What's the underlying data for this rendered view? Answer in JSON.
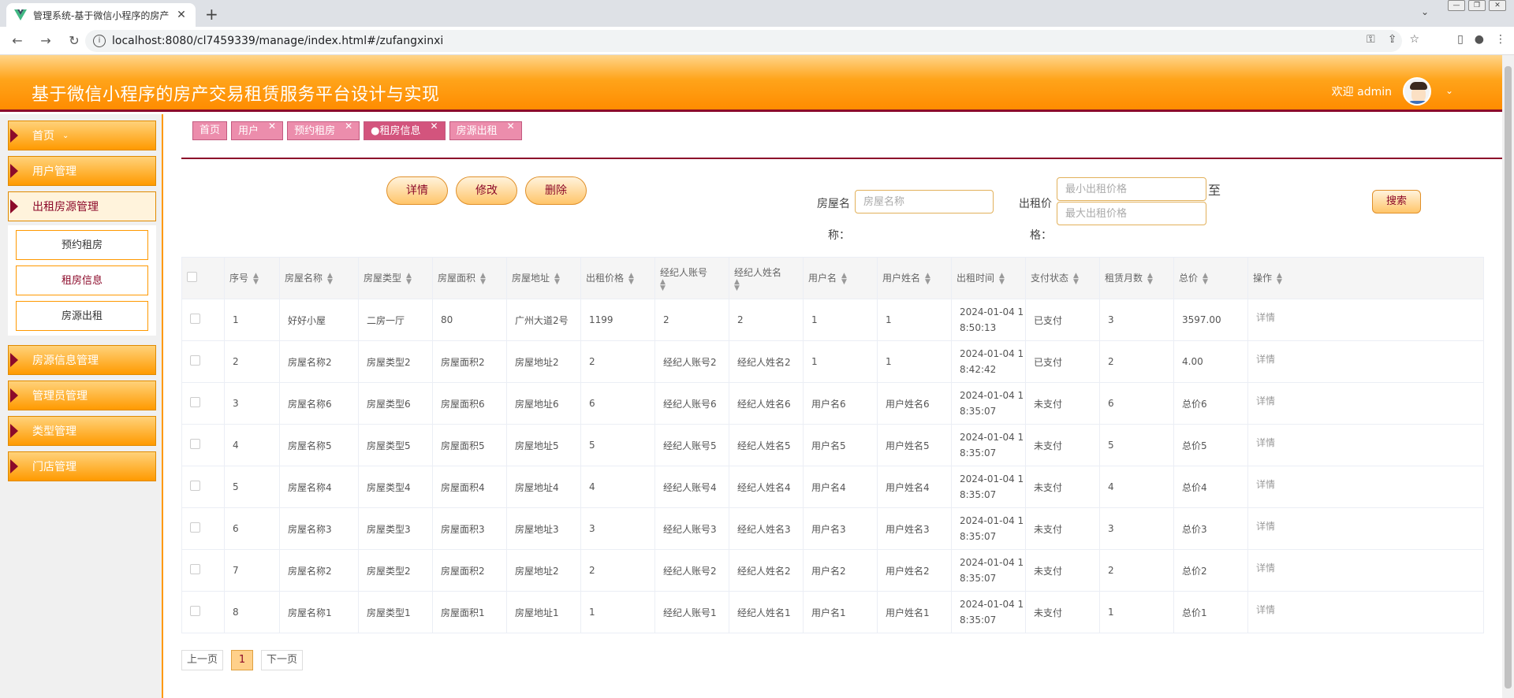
{
  "browser": {
    "tab_title": "管理系统-基于微信小程序的房产",
    "url": "localhost:8080/cl7459339/manage/index.html#/zufangxinxi"
  },
  "header": {
    "title": "基于微信小程序的房产交易租赁服务平台设计与实现",
    "welcome": "欢迎 admin"
  },
  "sidebar": {
    "items": [
      {
        "label": "首页"
      },
      {
        "label": "用户管理"
      },
      {
        "label": "出租房源管理"
      },
      {
        "label": "房源信息管理"
      },
      {
        "label": "管理员管理"
      },
      {
        "label": "类型管理"
      },
      {
        "label": "门店管理"
      }
    ],
    "submenu": [
      {
        "label": "预约租房"
      },
      {
        "label": "租房信息"
      },
      {
        "label": "房源出租"
      }
    ]
  },
  "tags": [
    {
      "label": "首页"
    },
    {
      "label": "用户"
    },
    {
      "label": "预约租房"
    },
    {
      "label": "●租房信息"
    },
    {
      "label": "房源出租"
    }
  ],
  "actions": {
    "detail": "详情",
    "edit": "修改",
    "delete": "删除"
  },
  "search": {
    "name_label_1": "房屋名",
    "name_label_2": "称：",
    "name_placeholder": "房屋名称",
    "price_label_1": "出租价",
    "price_label_2": "格：",
    "min_placeholder": "最小出租价格",
    "max_placeholder": "最大出租价格",
    "to": "至",
    "button": "搜索"
  },
  "table": {
    "columns": [
      "序号",
      "房屋名称",
      "房屋类型",
      "房屋面积",
      "房屋地址",
      "出租价格",
      "经纪人账号",
      "经纪人姓名",
      "用户名",
      "用户姓名",
      "出租时间",
      "支付状态",
      "租赁月数",
      "总价",
      "操作"
    ],
    "rows": [
      {
        "no": "1",
        "name": "好好小屋",
        "type": "二房一厅",
        "area": "80",
        "addr": "广州大道2号",
        "price": "1199",
        "agent_acc": "2",
        "agent_name": "2",
        "user": "1",
        "user_name": "1",
        "time_1": "2024-01-04 1",
        "time_2": "8:50:13",
        "status": "已支付",
        "months": "3",
        "total": "3597.00",
        "op": "详情"
      },
      {
        "no": "2",
        "name": "房屋名称2",
        "type": "房屋类型2",
        "area": "房屋面积2",
        "addr": "房屋地址2",
        "price": "2",
        "agent_acc": "经纪人账号2",
        "agent_name": "经纪人姓名2",
        "user": "1",
        "user_name": "1",
        "time_1": "2024-01-04 1",
        "time_2": "8:42:42",
        "status": "已支付",
        "months": "2",
        "total": "4.00",
        "op": "详情"
      },
      {
        "no": "3",
        "name": "房屋名称6",
        "type": "房屋类型6",
        "area": "房屋面积6",
        "addr": "房屋地址6",
        "price": "6",
        "agent_acc": "经纪人账号6",
        "agent_name": "经纪人姓名6",
        "user": "用户名6",
        "user_name": "用户姓名6",
        "time_1": "2024-01-04 1",
        "time_2": "8:35:07",
        "status": "未支付",
        "months": "6",
        "total": "总价6",
        "op": "详情"
      },
      {
        "no": "4",
        "name": "房屋名称5",
        "type": "房屋类型5",
        "area": "房屋面积5",
        "addr": "房屋地址5",
        "price": "5",
        "agent_acc": "经纪人账号5",
        "agent_name": "经纪人姓名5",
        "user": "用户名5",
        "user_name": "用户姓名5",
        "time_1": "2024-01-04 1",
        "time_2": "8:35:07",
        "status": "未支付",
        "months": "5",
        "total": "总价5",
        "op": "详情"
      },
      {
        "no": "5",
        "name": "房屋名称4",
        "type": "房屋类型4",
        "area": "房屋面积4",
        "addr": "房屋地址4",
        "price": "4",
        "agent_acc": "经纪人账号4",
        "agent_name": "经纪人姓名4",
        "user": "用户名4",
        "user_name": "用户姓名4",
        "time_1": "2024-01-04 1",
        "time_2": "8:35:07",
        "status": "未支付",
        "months": "4",
        "total": "总价4",
        "op": "详情"
      },
      {
        "no": "6",
        "name": "房屋名称3",
        "type": "房屋类型3",
        "area": "房屋面积3",
        "addr": "房屋地址3",
        "price": "3",
        "agent_acc": "经纪人账号3",
        "agent_name": "经纪人姓名3",
        "user": "用户名3",
        "user_name": "用户姓名3",
        "time_1": "2024-01-04 1",
        "time_2": "8:35:07",
        "status": "未支付",
        "months": "3",
        "total": "总价3",
        "op": "详情"
      },
      {
        "no": "7",
        "name": "房屋名称2",
        "type": "房屋类型2",
        "area": "房屋面积2",
        "addr": "房屋地址2",
        "price": "2",
        "agent_acc": "经纪人账号2",
        "agent_name": "经纪人姓名2",
        "user": "用户名2",
        "user_name": "用户姓名2",
        "time_1": "2024-01-04 1",
        "time_2": "8:35:07",
        "status": "未支付",
        "months": "2",
        "total": "总价2",
        "op": "详情"
      },
      {
        "no": "8",
        "name": "房屋名称1",
        "type": "房屋类型1",
        "area": "房屋面积1",
        "addr": "房屋地址1",
        "price": "1",
        "agent_acc": "经纪人账号1",
        "agent_name": "经纪人姓名1",
        "user": "用户名1",
        "user_name": "用户姓名1",
        "time_1": "2024-01-04 1",
        "time_2": "8:35:07",
        "status": "未支付",
        "months": "1",
        "total": "总价1",
        "op": "详情"
      }
    ]
  },
  "pagination": {
    "prev": "上一页",
    "current": "1",
    "next": "下一页"
  },
  "colors": {
    "brand_orange": "#ff9900",
    "brand_maroon": "#8c0a2a",
    "tag_pink": "#ec8dac"
  }
}
